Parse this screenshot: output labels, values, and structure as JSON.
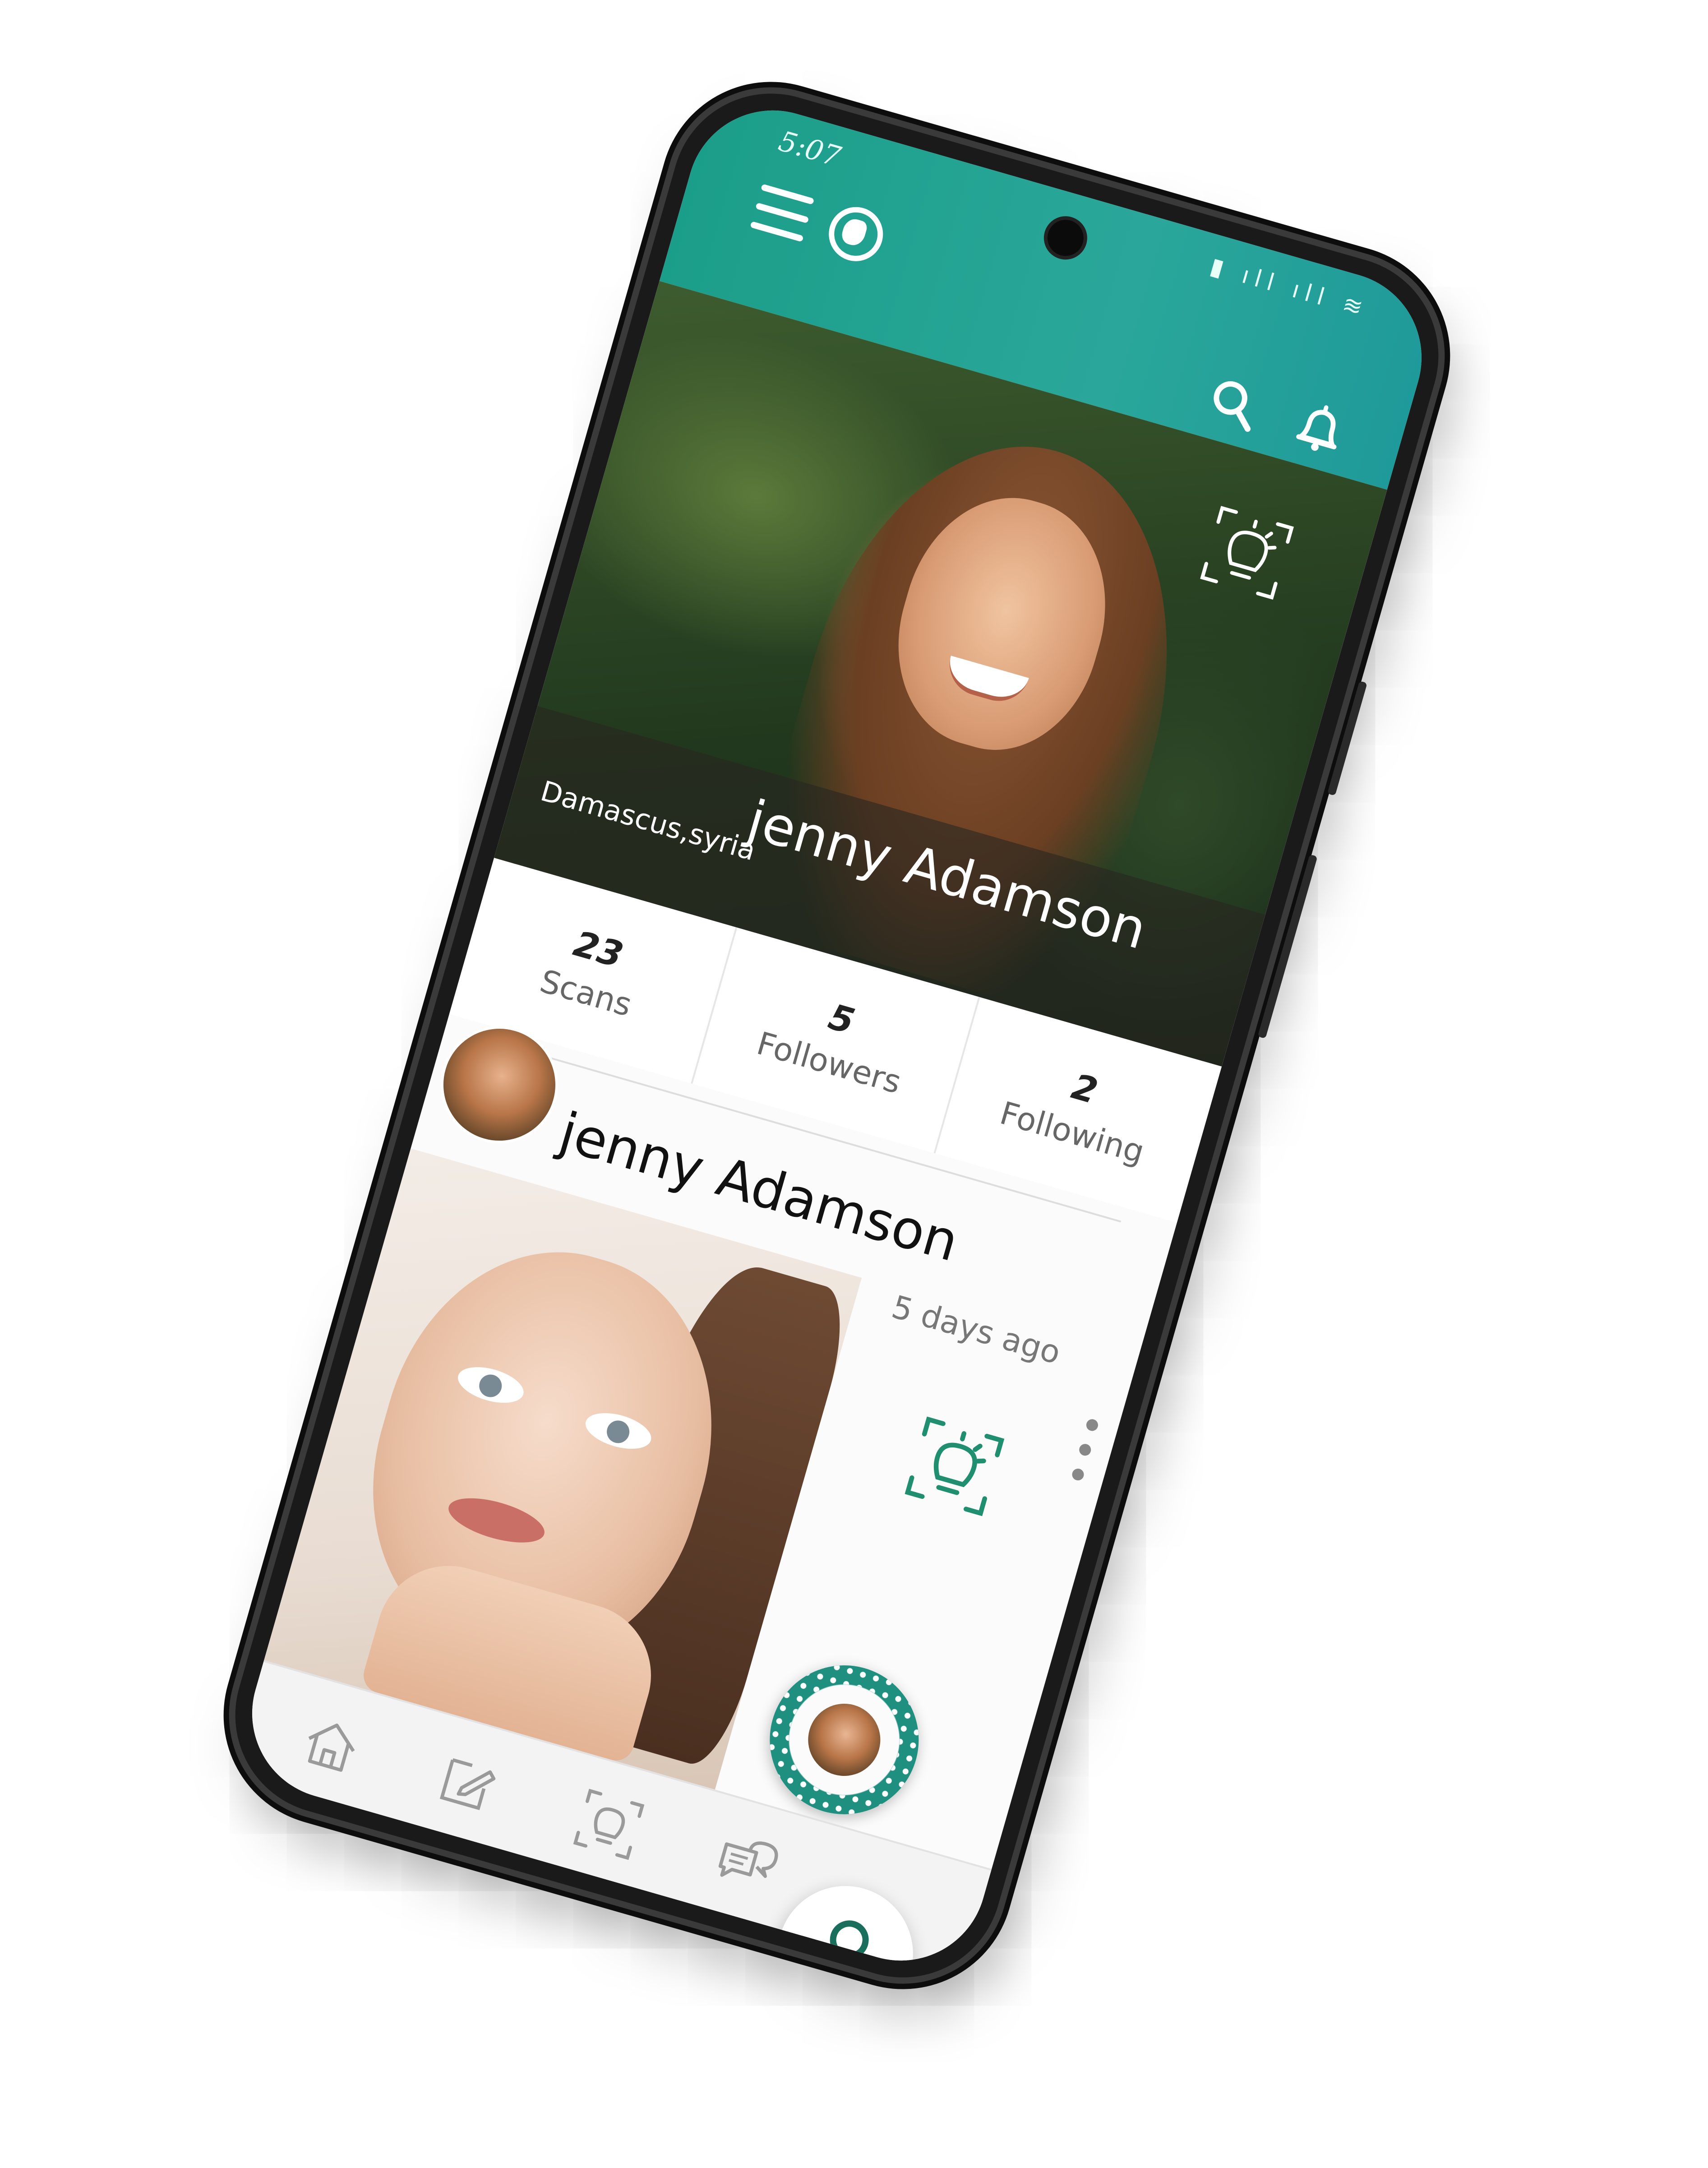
{
  "status_bar": {
    "time": "5:07",
    "icons": "▮ ıll ıll ≋"
  },
  "app_bar": {
    "icons": [
      "menu-icon",
      "globe-icon",
      "search-icon",
      "bell-icon"
    ],
    "accent": "#1b9e89"
  },
  "profile": {
    "name": "jenny Adamson",
    "location": "Damascus,syria"
  },
  "stats": [
    {
      "value": "23",
      "label": "Scans"
    },
    {
      "value": "5",
      "label": "Followers"
    },
    {
      "value": "2",
      "label": "Following"
    }
  ],
  "post": {
    "author": "jenny Adamson",
    "time": "5 days ago"
  },
  "bottom_nav": {
    "items": [
      "home-icon",
      "edit-icon",
      "scan-icon",
      "chat-icon",
      "profile-icon"
    ],
    "active": "profile-icon",
    "active_color": "#1a6e5c"
  },
  "system_nav": [
    "recents-icon",
    "home-button-icon",
    "back-icon"
  ]
}
